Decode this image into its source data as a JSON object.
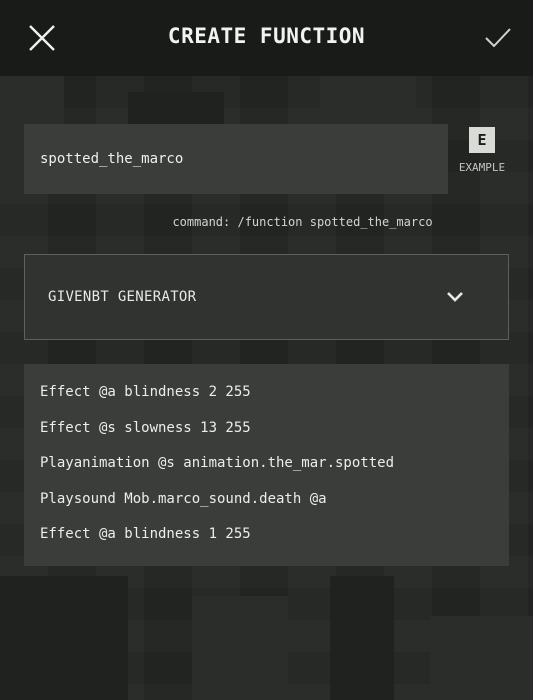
{
  "header": {
    "title": "CREATE FUNCTION",
    "close_icon": "close-icon",
    "confirm_icon": "checkmark-icon"
  },
  "function_name": {
    "value": "spotted_the_marco"
  },
  "example": {
    "badge": "E",
    "label": "EXAMPLE"
  },
  "command_hint": "command: /function spotted_the_marco",
  "generator": {
    "selected": "GIVENBT GENERATOR",
    "icon": "chevron-down-icon"
  },
  "commands": [
    "Effect @a blindness 2 255",
    "Effect @s slowness 13 255",
    "Playanimation @s animation.the_mar.spotted",
    "Playsound Mob.marco_sound.death @a",
    "Effect @a blindness 1 255"
  ],
  "colors": {
    "background": "#232623",
    "topbar": "#191b19",
    "field": "#3a3d3a",
    "text": "#eceee9"
  }
}
